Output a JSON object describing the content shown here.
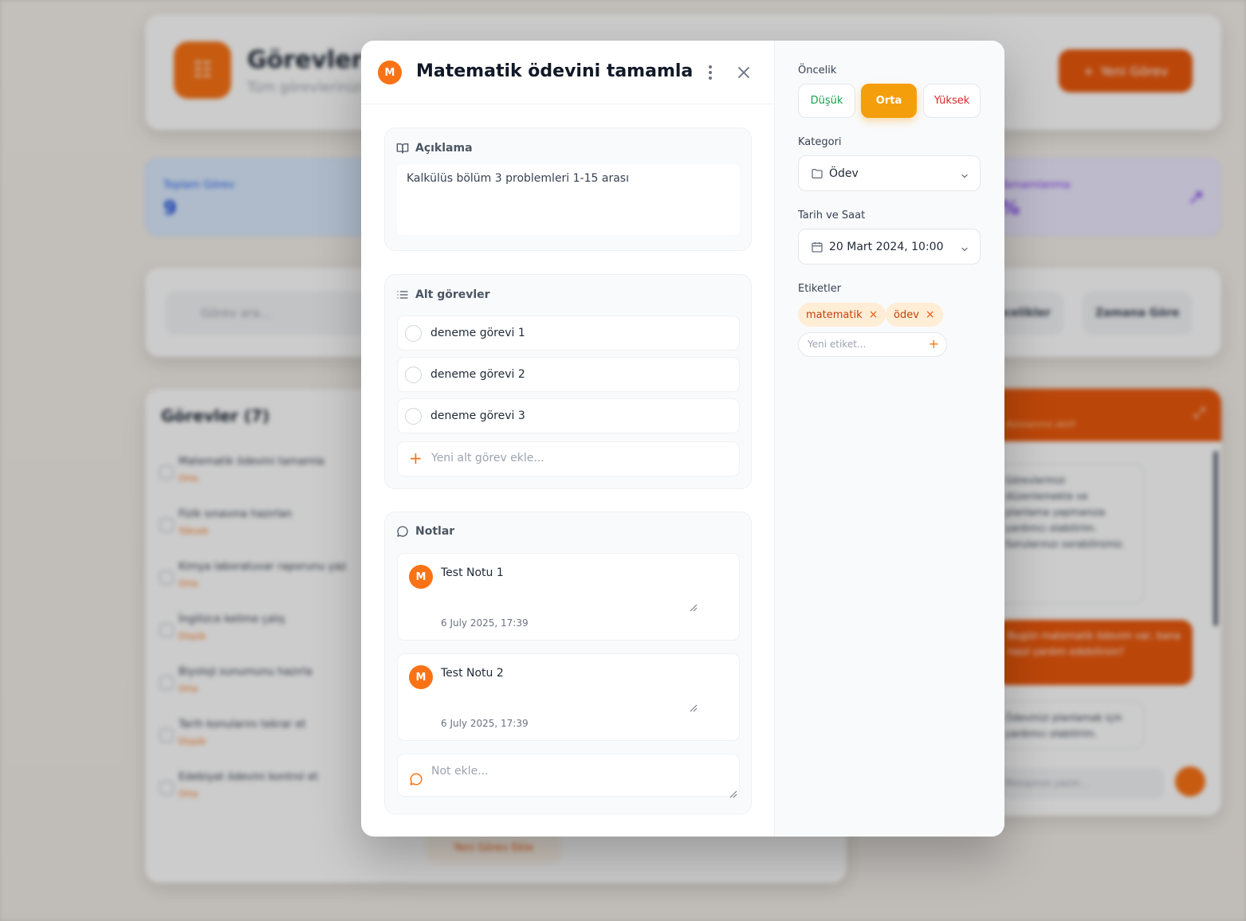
{
  "background": {
    "app_title": "Görevler",
    "app_subtitle": "Tüm görevlerinizi",
    "new_task_button": "Yeni Görev",
    "stat_total_label": "Toplam Görev",
    "stat_total_value": "9",
    "stat_completion_label": "Tamamlanma",
    "stat_completion_value": "%",
    "search_placeholder": "Görev ara...",
    "filter_priority": "Öncelikler",
    "filter_sort": "Zamana Göre",
    "tasks_title": "Görevler (7)",
    "tasks": [
      {
        "name": "Matematik ödevini tamamla",
        "meta": "Orta"
      },
      {
        "name": "Fizik sınavına hazırlan",
        "meta": "Yüksek"
      },
      {
        "name": "Kimya laboratuvar raporunu yaz",
        "meta": "Orta"
      },
      {
        "name": "İngilizce kelime çalış",
        "meta": "Düşük"
      },
      {
        "name": "Biyoloji sunumunu hazırla",
        "meta": "Orta"
      },
      {
        "name": "Tarih konularını tekrar et",
        "meta": "Düşük"
      },
      {
        "name": "Edebiyat ödevini kontrol et",
        "meta": "Orta"
      }
    ],
    "add_task_button": "Yeni Görev Ekle",
    "chat_subtitle": "Asistanınız aktif",
    "chat_bot_message_1": "Görevlerinizi düzenlemekte ve planlama yapmanıza yardımcı olabilirim. Sorularınızı sorabilirsiniz.",
    "chat_user_message": "Bugün matematik ödevim var, bana nasıl yardım edebilirsin?",
    "chat_bot_message_2": "Ödevinizi planlamak için yardımcı olabilirim.",
    "chat_input_placeholder": "Mesajınızı yazın..."
  },
  "modal": {
    "avatar_letter": "M",
    "title": "Matematik ödevini tamamla",
    "description": {
      "heading": "Açıklama",
      "text": "Kalkülüs bölüm 3 problemleri 1-15 arası"
    },
    "subtasks": {
      "heading": "Alt görevler",
      "items": [
        "deneme görevi 1",
        "deneme görevi 2",
        "deneme görevi 3"
      ],
      "add_placeholder": "Yeni alt görev ekle..."
    },
    "notes": {
      "heading": "Notlar",
      "items": [
        {
          "avatar": "M",
          "text": "Test Notu 1",
          "date": "6 July 2025, 17:39"
        },
        {
          "avatar": "M",
          "text": "Test Notu 2",
          "date": "6 July 2025, 17:39"
        }
      ],
      "add_placeholder": "Not ekle..."
    },
    "side": {
      "priority_label": "Öncelik",
      "priority_options": [
        "Düşük",
        "Orta",
        "Yüksek"
      ],
      "priority_selected": "Orta",
      "category_label": "Kategori",
      "category_value": "Ödev",
      "datetime_label": "Tarih ve Saat",
      "datetime_value": "20 Mart 2024, 10:00",
      "tags_label": "Etiketler",
      "tags": [
        "matematik",
        "ödev"
      ],
      "tag_input_placeholder": "Yeni etiket..."
    }
  },
  "colors": {
    "accent": "#f97316",
    "priority_low": "#16a34a",
    "priority_mid": "#f59e0b",
    "priority_high": "#dc2626"
  }
}
